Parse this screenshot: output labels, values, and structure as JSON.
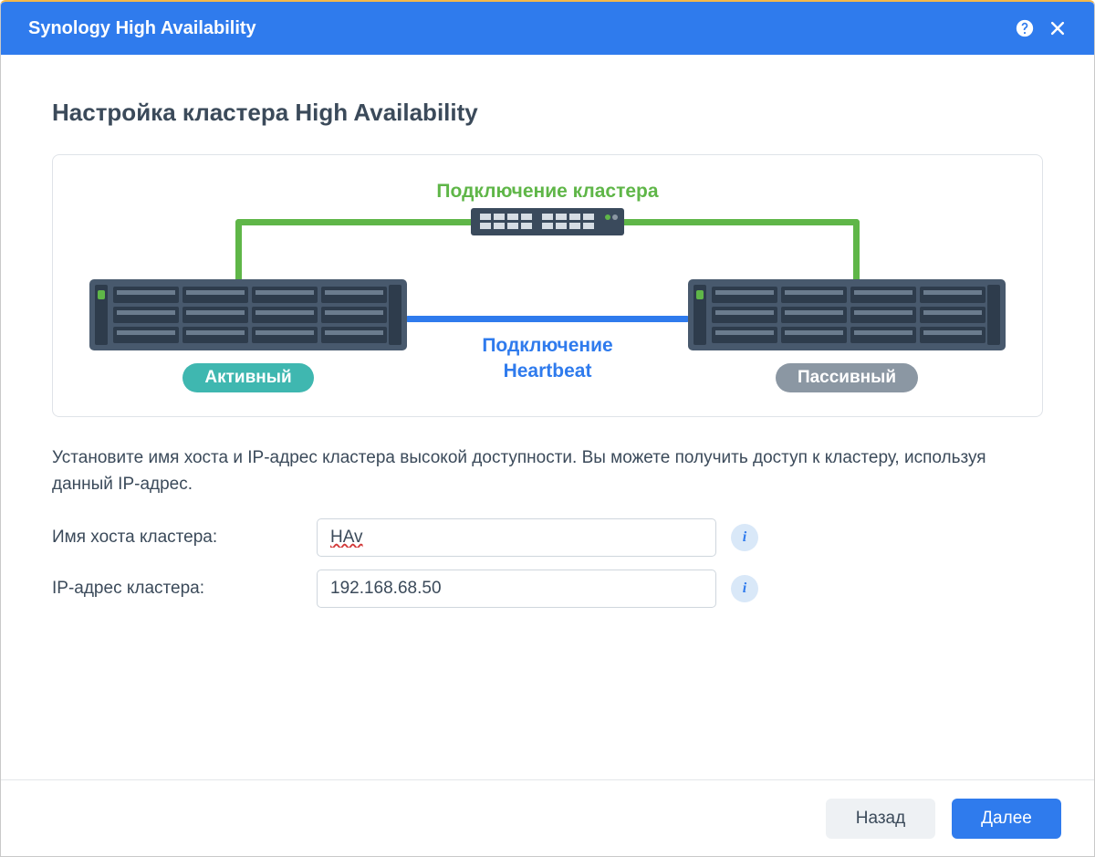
{
  "window": {
    "title": "Synology High Availability"
  },
  "page": {
    "heading": "Настройка кластера High Availability",
    "diagram": {
      "cluster_connection_label": "Подключение кластера",
      "heartbeat_label_line1": "Подключение",
      "heartbeat_label_line2": "Heartbeat",
      "active_badge": "Активный",
      "passive_badge": "Пассивный"
    },
    "description": "Установите имя хоста и IP-адрес кластера высокой доступности. Вы можете получить доступ к кластеру, используя данный IP-адрес.",
    "form": {
      "hostname_label": "Имя хоста кластера:",
      "hostname_value": "HAv",
      "ip_label": "IP-адрес кластера:",
      "ip_value": "192.168.68.50"
    }
  },
  "footer": {
    "back": "Назад",
    "next": "Далее"
  },
  "colors": {
    "primary": "#2f7bed",
    "green": "#5fb648",
    "teal": "#3fb7b0",
    "gray": "#8b97a3"
  }
}
